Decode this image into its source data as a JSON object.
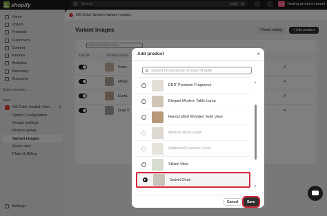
{
  "topbar": {
    "logo_text": "shopify",
    "search_placeholder": "Search",
    "shortcut_keys": [
      "CTRL",
      "K"
    ],
    "store_initials": "Tpv",
    "store_name": "Testing product variant"
  },
  "sidebar": {
    "items": [
      {
        "label": "Home",
        "icon": "home-icon"
      },
      {
        "label": "Orders",
        "icon": "orders-icon"
      },
      {
        "label": "Products",
        "icon": "tag-icon"
      },
      {
        "label": "Customers",
        "icon": "person-icon"
      },
      {
        "label": "Content",
        "icon": "content-icon"
      },
      {
        "label": "Finance",
        "icon": "bank-icon"
      },
      {
        "label": "Analytics",
        "icon": "chart-icon"
      },
      {
        "label": "Marketing",
        "icon": "target-icon"
      },
      {
        "label": "Discounts",
        "icon": "discount-icon"
      }
    ],
    "sales_channels_label": "Sales channels",
    "apps_label": "Apps",
    "app_name": "NS Color Swatch Vari...",
    "app_subitems": [
      "Option Configuration",
      "Design settings",
      "Product group",
      "Variant images",
      "Quick view",
      "Plans & Billing"
    ],
    "active_item": "Variant images",
    "settings_label": "Settings"
  },
  "main": {
    "app_title": "NS Color Swatch Variant Images",
    "page_title": "Variant images",
    "theme_setting_label": "Theme setting",
    "add_product_label": "+ Add product",
    "search_placeholder": "Search product name",
    "columns": [
      "On/Off",
      "Product name"
    ],
    "rows": [
      {
        "name": "Patte",
        "count": "4"
      },
      {
        "name": "Minim",
        "count": "4"
      },
      {
        "name": "Curta",
        "count": "4"
      },
      {
        "name": "Dual V",
        "count": "4"
      }
    ]
  },
  "modal": {
    "title": "Add product",
    "close_icon": "close-icon",
    "search_placeholder": "Search his products on your Shopify",
    "products": [
      {
        "name": "EDIT Premium Fragrance",
        "disabled": false,
        "selected": false
      },
      {
        "name": "Elegant Modern Table Lamp",
        "disabled": false,
        "selected": false
      },
      {
        "name": "Handcrafted Wooden Swirl Vase",
        "disabled": false,
        "selected": false
      },
      {
        "name": "Minimal Work Lamp",
        "disabled": true,
        "selected": false
      },
      {
        "name": "Patterned Cushion Cover",
        "disabled": true,
        "selected": false
      },
      {
        "name": "Stilren Vase",
        "disabled": false,
        "selected": false
      },
      {
        "name": "Swivel Chair",
        "disabled": false,
        "selected": true
      }
    ],
    "cancel_label": "Cancel",
    "save_label": "Save"
  }
}
